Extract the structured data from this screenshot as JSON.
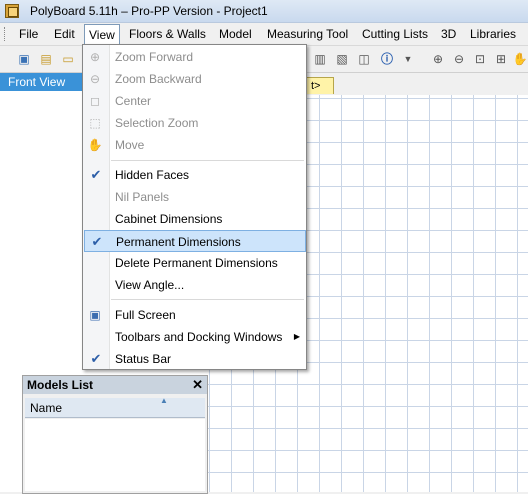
{
  "window": {
    "title": "PolyBoard 5.11h – Pro-PP Version - Project1"
  },
  "menubar": [
    {
      "label": "File"
    },
    {
      "label": "Edit"
    },
    {
      "label": "View"
    },
    {
      "label": "Floors & Walls"
    },
    {
      "label": "Model"
    },
    {
      "label": "Measuring Tool"
    },
    {
      "label": "Cutting Lists"
    },
    {
      "label": "3D"
    },
    {
      "label": "Libraries"
    }
  ],
  "left_panel": {
    "header": "Front View"
  },
  "doc_tab": {
    "label": "t>"
  },
  "view_menu": {
    "items": [
      {
        "label": "Zoom Forward",
        "icon": "zoom-in-icon",
        "enabled": false
      },
      {
        "label": "Zoom Backward",
        "icon": "zoom-out-icon",
        "enabled": false
      },
      {
        "label": "Center",
        "icon": "center-icon",
        "enabled": false
      },
      {
        "label": "Selection Zoom",
        "icon": "selection-zoom-icon",
        "enabled": false
      },
      {
        "label": "Move",
        "icon": "hand-icon",
        "enabled": false
      },
      {
        "label": "Hidden Faces",
        "checked": true,
        "enabled": true
      },
      {
        "label": "Nil Panels",
        "enabled": false
      },
      {
        "label": "Cabinet Dimensions",
        "enabled": true
      },
      {
        "label": "Permanent Dimensions",
        "checked": true,
        "highlighted": true,
        "enabled": true
      },
      {
        "label": "Delete Permanent Dimensions",
        "enabled": true
      },
      {
        "label": "View Angle...",
        "enabled": true
      },
      {
        "label": "Full Screen",
        "icon": "full-screen-icon",
        "enabled": true
      },
      {
        "label": "Toolbars and Docking Windows",
        "submenu": true,
        "enabled": true
      },
      {
        "label": "Status Bar",
        "checked": true,
        "enabled": true
      }
    ]
  },
  "models_list": {
    "title": "Models List",
    "close": "✕",
    "column": "Name"
  },
  "colors": {
    "highlight": "#cde4fb",
    "panel_header": "#3a92d8",
    "grid": "#c9d5e6"
  }
}
